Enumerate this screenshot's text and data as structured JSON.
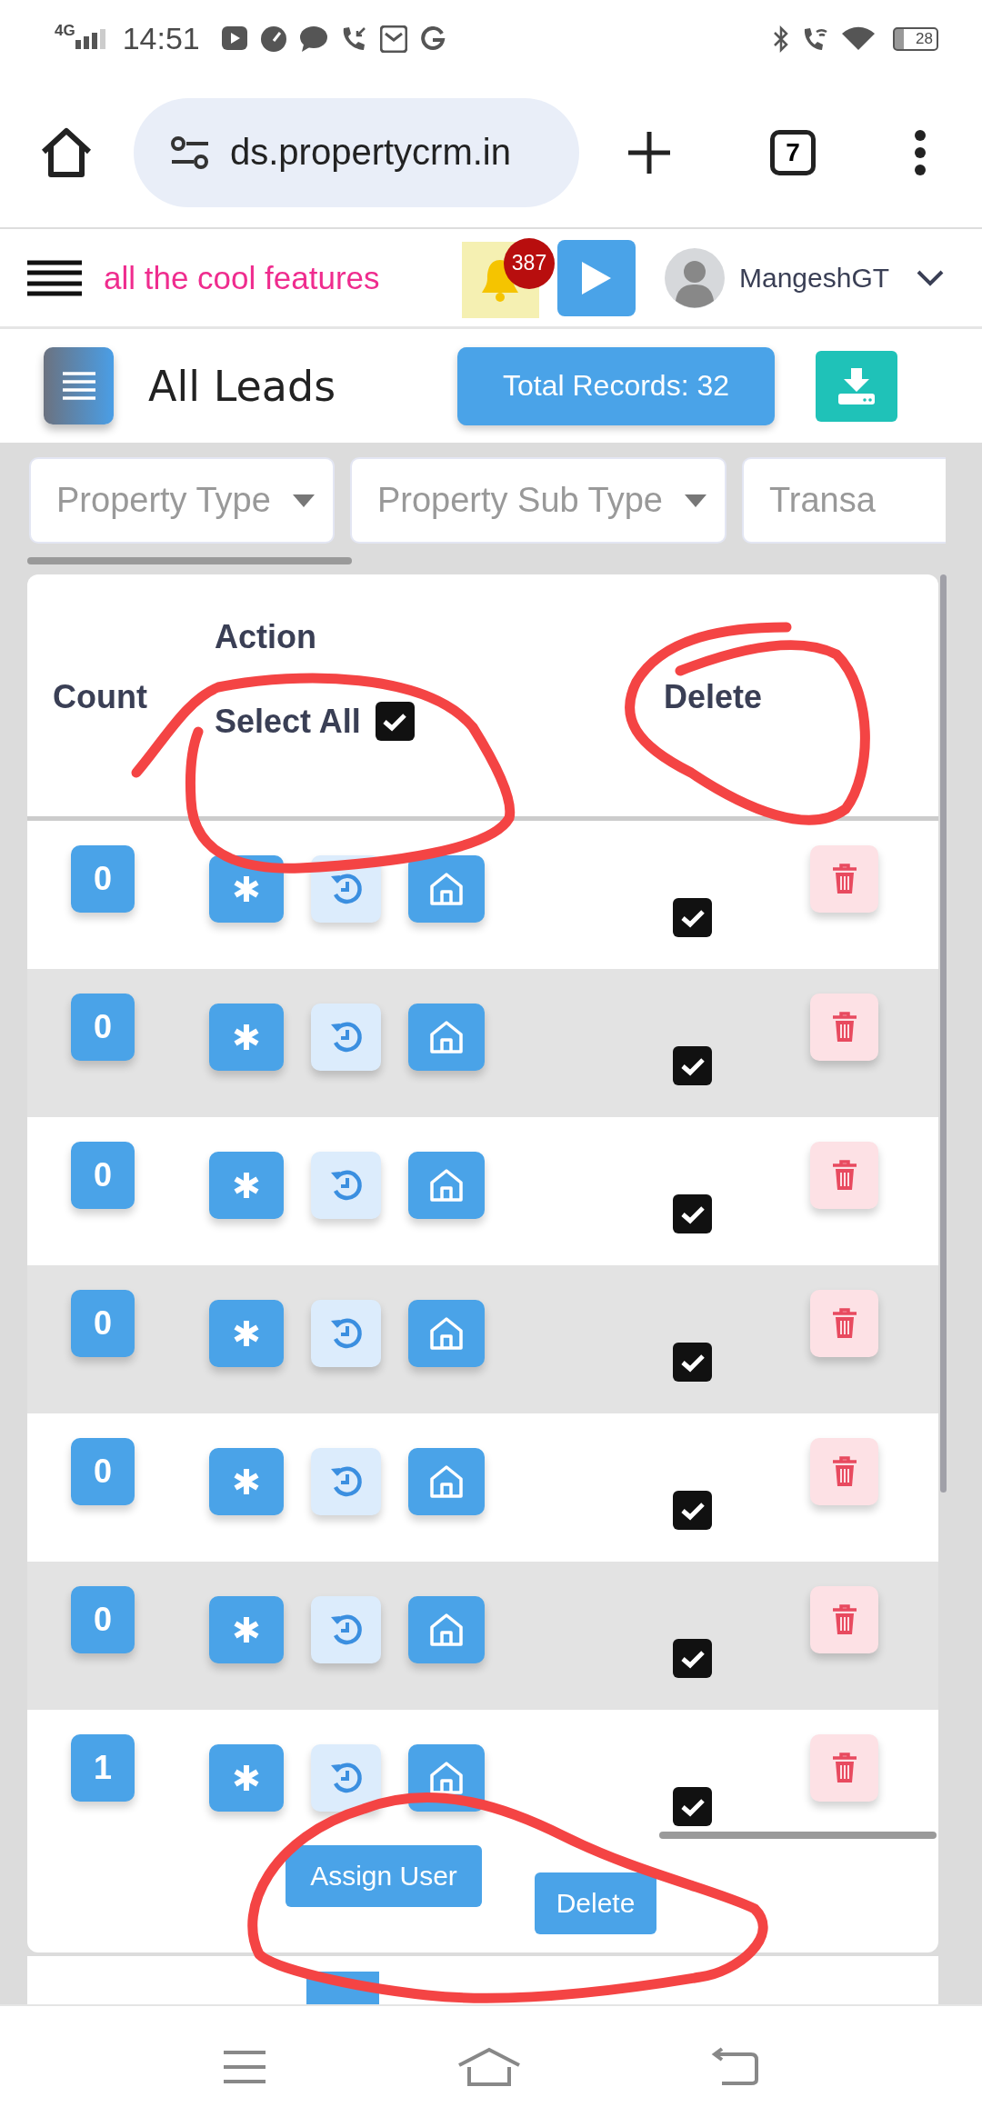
{
  "status_bar": {
    "network": "4G",
    "time": "14:51",
    "battery": "28"
  },
  "browser": {
    "url": "ds.propertycrm.in",
    "tab_count": "7"
  },
  "app_header": {
    "marquee": "all the cool features",
    "notification_count": "387",
    "user_name": "MangeshGT"
  },
  "page": {
    "title": "All Leads",
    "total_records": "Total Records: 32"
  },
  "filters": [
    {
      "label": "Property Type",
      "clipped": false
    },
    {
      "label": "Property Sub Type",
      "clipped": false
    },
    {
      "label": "Transa",
      "clipped": true
    }
  ],
  "table": {
    "columns": {
      "count": "Count",
      "action": "Action",
      "select_all": "Select All",
      "delete": "Delete"
    },
    "select_all_checked": true,
    "rows": [
      {
        "count": "0",
        "delete_checked": true
      },
      {
        "count": "0",
        "delete_checked": true
      },
      {
        "count": "0",
        "delete_checked": true
      },
      {
        "count": "0",
        "delete_checked": true
      },
      {
        "count": "0",
        "delete_checked": true
      },
      {
        "count": "0",
        "delete_checked": true
      },
      {
        "count": "1",
        "delete_checked": true
      }
    ]
  },
  "footer_buttons": [
    "Assign User",
    "Delete"
  ]
}
